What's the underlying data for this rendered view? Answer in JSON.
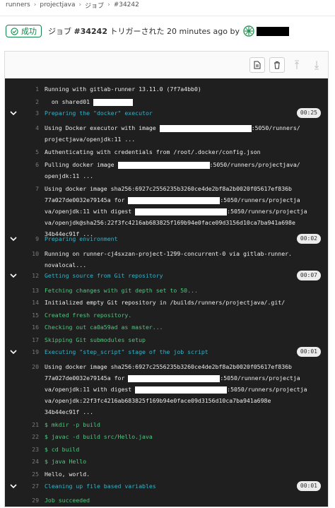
{
  "breadcrumb": [
    "runners",
    "projectjava",
    "ジョブ",
    "#34242"
  ],
  "header": {
    "status_label": "成功",
    "job_prefix": "ジョブ",
    "job_id": "#34242",
    "triggered_text": "トリガーされた 20 minutes ago by"
  },
  "colors": {
    "success": "#108548",
    "terminal_bg": "#1f1f1f",
    "section": "#34b3c9",
    "command": "#51c57f"
  },
  "toolbar": {
    "icons": [
      "file-icon",
      "trash-icon",
      "scroll-top-icon",
      "scroll-bottom-icon"
    ]
  },
  "log": {
    "l1": "Running with gitlab-runner 13.11.0 (7f7a4bb0)",
    "l2": "on shared01",
    "l3": "Preparing the \"docker\" executor",
    "l3_d": "00:25",
    "l4a": "Using Docker executor with image",
    "l4b": ":5050/runners/",
    "l4c": "projectjava/openjdk:11 ...",
    "l5": "Authenticating with credentials from /root/.docker/config.json",
    "l6a": "Pulling docker image",
    "l6b": ":5050/runners/projectjava/",
    "l6c": "openjdk:11 ...",
    "l7a": "Using docker image sha256:6927c2556235b3260ce4de2bf8a2b0020f05617ef836b",
    "l7b": "77a027de0032e79145a for",
    "l7c": ":5050/runners/projectja",
    "l7d": "va/openjdk:11 with digest",
    "l7e": ":5050/runners/projectja",
    "l7f": "va/openjdk@sha256:22f3fc4216ab683825f169b94e0face09d3156d10ca7ba941a698e",
    "l7g": "34b44ec91f ...",
    "l9": "Preparing environment",
    "l9_d": "00:02",
    "l10a": "Running on runner-cj4sxzan-project-1299-concurrent-0 via gitlab-runner.",
    "l10b": "novalocal...",
    "l12": "Getting source from Git repository",
    "l12_d": "00:07",
    "l13": "Fetching changes with git depth set to 50...",
    "l14": "Initialized empty Git repository in /builds/runners/projectjava/.git/",
    "l15": "Created fresh repository.",
    "l16": "Checking out ca0a59ad as master...",
    "l17": "Skipping Git submodules setup",
    "l19": "Executing \"step_script\" stage of the job script",
    "l19_d": "00:01",
    "l20a": "Using docker image sha256:6927c2556235b3260ce4de2bf8a2b0020f05617ef836b",
    "l20b": "77a027de0032e79145a for",
    "l20c": ":5050/runners/projectja",
    "l20d": "va/openjdk:11 with digest",
    "l20e": ":5050/runners/projectja",
    "l20f": "va/openjdk:22f3fc4216ab683825f169b94e0face09d3156d10ca7ba941a698e",
    "l20g": "34b44ec91f ...",
    "l21": "$ mkdir -p build",
    "l22": "$ javac -d build src/Hello.java",
    "l23": "$ cd build",
    "l24": "$ java Hello",
    "l25": "Hello, world.",
    "l27": "Cleaning up file based variables",
    "l27_d": "00:01",
    "l29": "Job succeeded",
    "nums": [
      "1",
      "2",
      "3",
      "4",
      "5",
      "6",
      "7",
      "9",
      "10",
      "12",
      "13",
      "14",
      "15",
      "16",
      "17",
      "19",
      "20",
      "21",
      "22",
      "23",
      "24",
      "25",
      "27",
      "29"
    ]
  }
}
